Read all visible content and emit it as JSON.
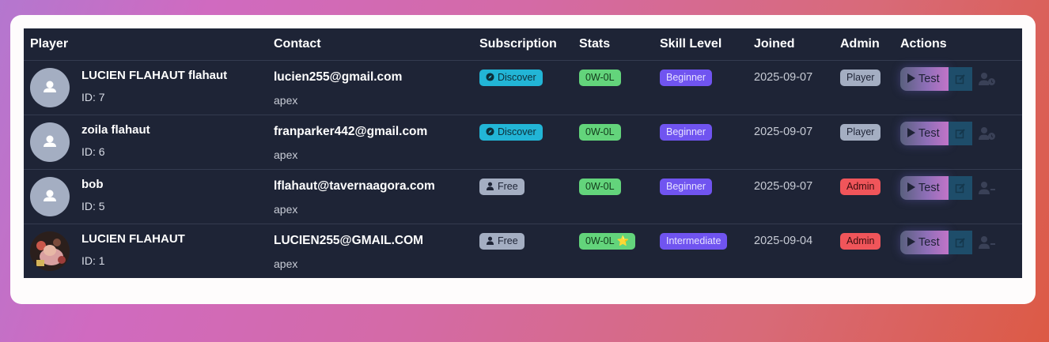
{
  "colors": {
    "table_bg": "#1e2436",
    "discover": "#22b5d6",
    "free": "#a4aec2",
    "stats": "#63d47b",
    "skill": "#7054f0",
    "player_role": "#a4aec2",
    "admin_role": "#f0555a"
  },
  "headers": {
    "player": "Player",
    "contact": "Contact",
    "subscription": "Subscription",
    "stats": "Stats",
    "skill": "Skill Level",
    "joined": "Joined",
    "admin": "Admin",
    "actions": "Actions"
  },
  "rows": [
    {
      "name": "LUCIEN FLAHAUT flahaut",
      "id": "ID: 7",
      "email": "lucien255@gmail.com",
      "org": "apex",
      "subscription": "Discover",
      "stats": "0W-0L",
      "skill": "Beginner",
      "joined": "2025-09-07",
      "role": "Player",
      "test": "Test",
      "avatar_icon": "default-user-icon",
      "action_icon": "user-clock-icon"
    },
    {
      "name": "zoila flahaut",
      "id": "ID: 6",
      "email": "franparker442@gmail.com",
      "org": "apex",
      "subscription": "Discover",
      "stats": "0W-0L",
      "skill": "Beginner",
      "joined": "2025-09-07",
      "role": "Player",
      "test": "Test",
      "avatar_icon": "default-user-icon",
      "action_icon": "user-clock-icon"
    },
    {
      "name": "bob",
      "id": "ID: 5",
      "email": "lflahaut@tavernaagora.com",
      "org": "apex",
      "subscription": "Free",
      "stats": "0W-0L",
      "skill": "Beginner",
      "joined": "2025-09-07",
      "role": "Admin",
      "test": "Test",
      "avatar_icon": "default-user-icon",
      "action_icon": "user-minus-icon"
    },
    {
      "name": "LUCIEN FLAHAUT",
      "id": "ID: 1",
      "email": "LUCIEN255@GMAIL.COM",
      "org": "apex",
      "subscription": "Free",
      "stats": "0W-0L ⭐",
      "skill": "Intermediate",
      "joined": "2025-09-04",
      "role": "Admin",
      "test": "Test",
      "avatar_icon": "profile-photo",
      "action_icon": "user-minus-icon"
    }
  ]
}
